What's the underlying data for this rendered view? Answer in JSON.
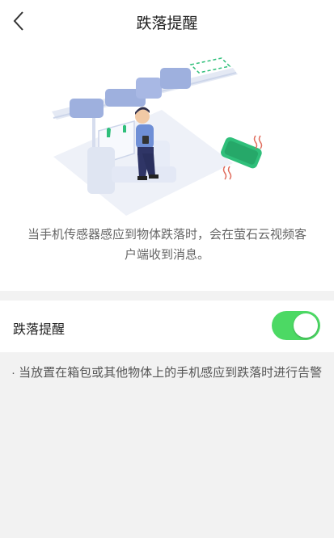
{
  "header": {
    "title": "跌落提醒",
    "back_icon": "chevron-left-icon"
  },
  "hero": {
    "illustration": "person-on-train-with-falling-phone",
    "description": "当手机传感器感应到物体跌落时，会在萤石云视频客户端收到消息。"
  },
  "setting": {
    "label": "跌落提醒",
    "enabled": true,
    "accent_color": "#4cd964"
  },
  "note": {
    "text": "· 当放置在箱包或其他物体上的手机感应到跌落时进行告警"
  }
}
